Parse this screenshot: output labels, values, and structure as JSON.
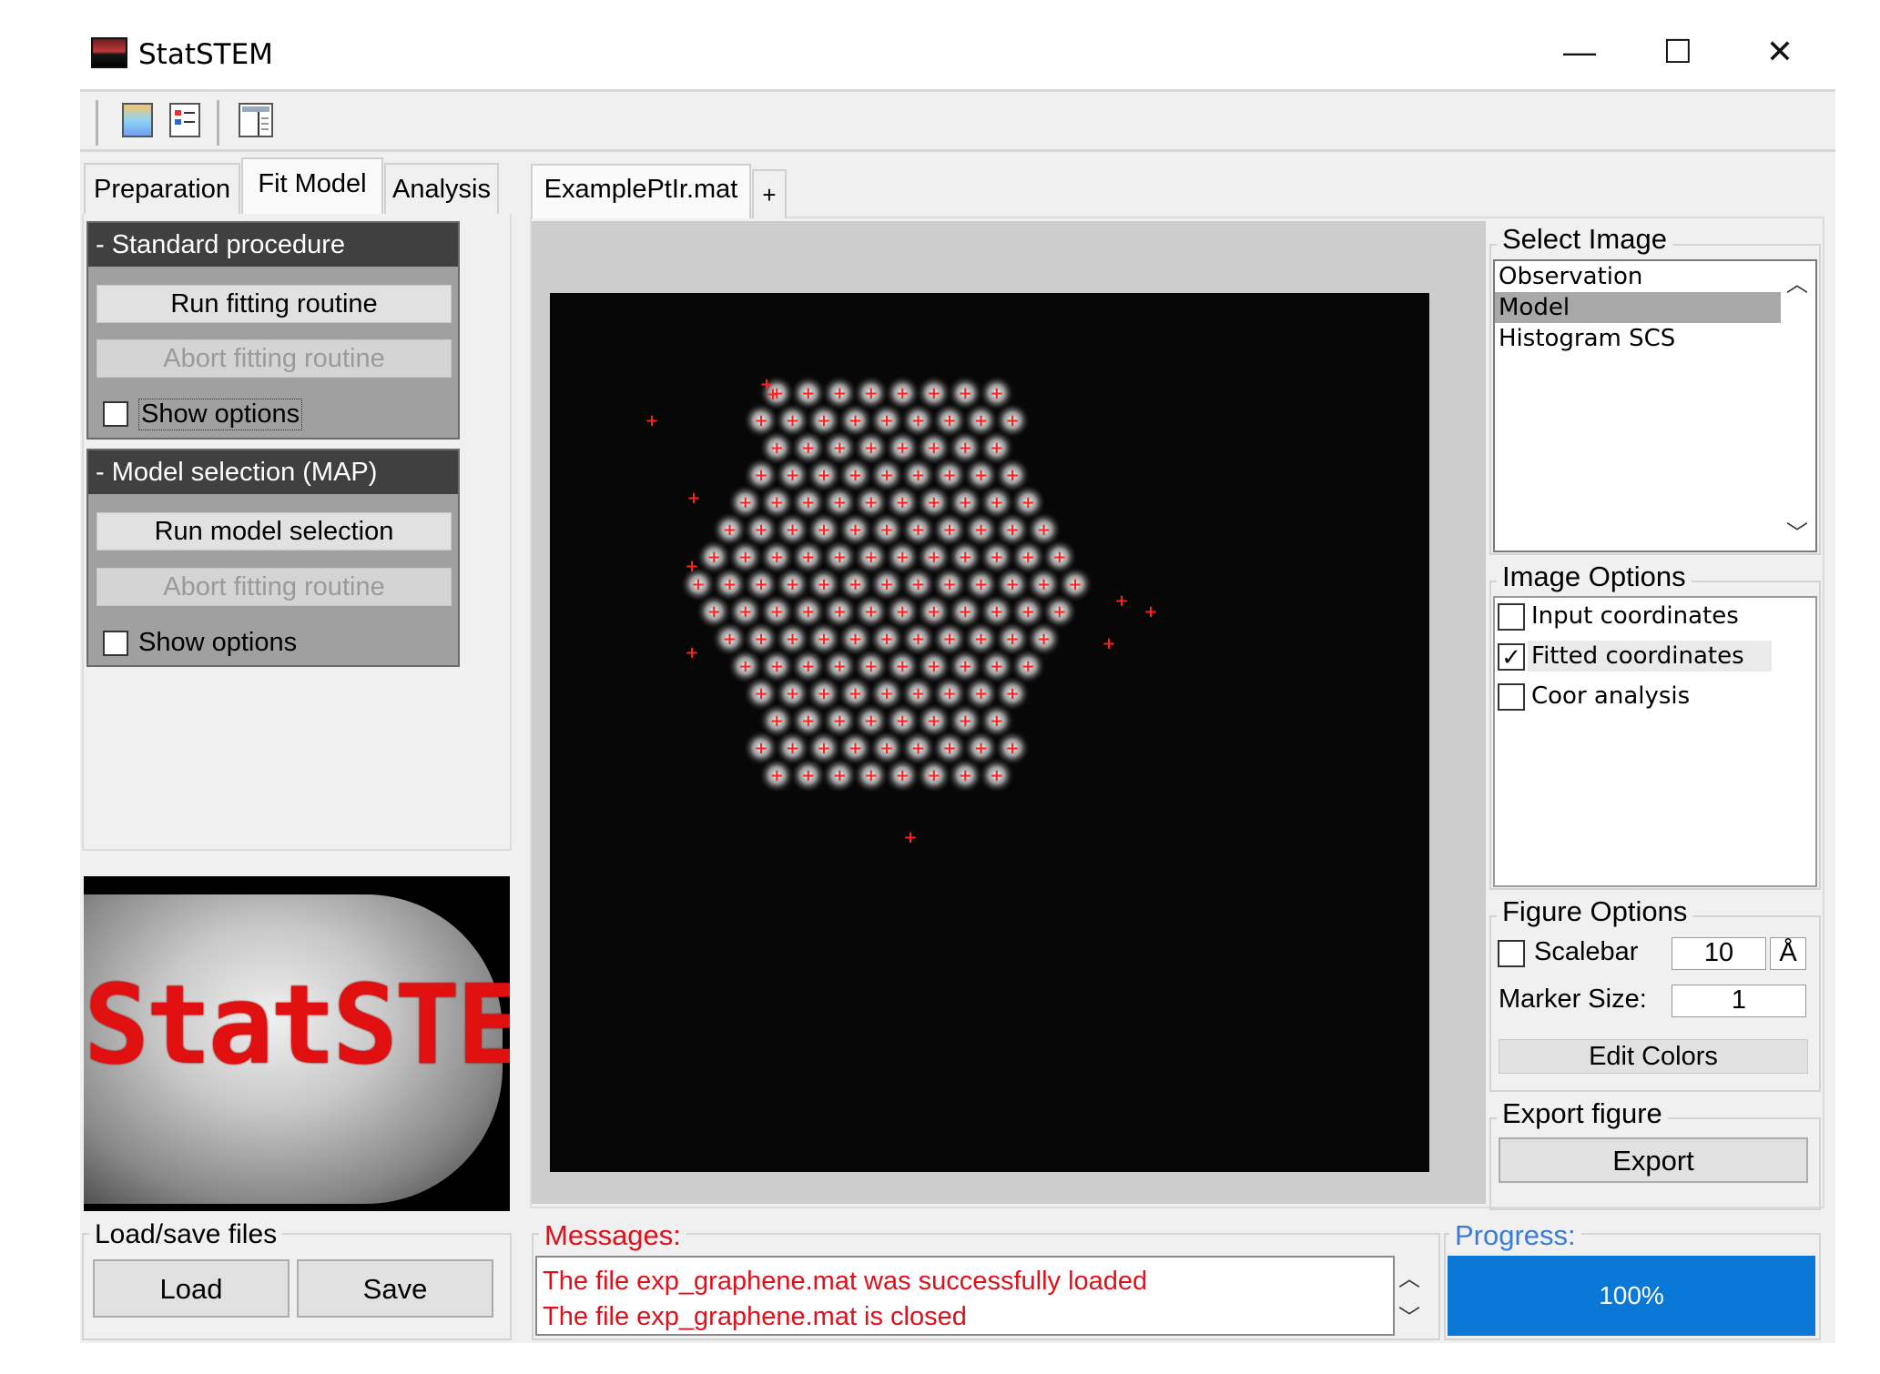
{
  "window": {
    "title": "StatSTEM",
    "minimize": "—",
    "maximize": "☐",
    "close": "✕"
  },
  "toolbar": {
    "icons": [
      "colorbar-icon",
      "legend-icon",
      "panel-layout-icon"
    ]
  },
  "left_tabs": [
    {
      "label": "Preparation"
    },
    {
      "label": "Fit Model",
      "active": true
    },
    {
      "label": "Analysis"
    }
  ],
  "standard_procedure": {
    "header": "- Standard procedure",
    "run_button": "Run fitting routine",
    "abort_button": "Abort fitting routine",
    "show_options": "Show options"
  },
  "model_selection": {
    "header": "- Model selection (MAP)",
    "run_button": "Run model selection",
    "abort_button": "Abort fitting routine",
    "show_options": "Show options"
  },
  "logo_text": "StatSTEM",
  "load_save": {
    "legend": "Load/save files",
    "load": "Load",
    "save": "Save"
  },
  "doc_tabs": [
    {
      "label": "ExamplePtIr.mat"
    },
    {
      "label": "+"
    }
  ],
  "select_image": {
    "legend": "Select Image",
    "items": [
      "Observation",
      "Model",
      "Histogram SCS"
    ],
    "selected": "Model"
  },
  "image_options": {
    "legend": "Image Options",
    "items": [
      {
        "label": "Input coordinates",
        "checked": false
      },
      {
        "label": "Fitted coordinates",
        "checked": true
      },
      {
        "label": "Coor analysis",
        "checked": false
      }
    ]
  },
  "figure_options": {
    "legend": "Figure Options",
    "scalebar_label": "Scalebar",
    "scalebar_value": "10",
    "scalebar_unit": "Å",
    "marker_label": "Marker Size:",
    "marker_value": "1",
    "edit_colors": "Edit Colors"
  },
  "export": {
    "legend": "Export figure",
    "button": "Export"
  },
  "messages": {
    "legend": "Messages:",
    "lines": [
      "The file exp_graphene.mat was successfully loaded",
      "The file exp_graphene.mat is closed"
    ]
  },
  "progress": {
    "legend": "Progress:",
    "label": "100%",
    "value": 1.0
  },
  "colors": {
    "marker": "#ff2020",
    "progress": "#0a78d7",
    "message_text": "#e0101a",
    "legend_blue": "#3a7bd5"
  }
}
